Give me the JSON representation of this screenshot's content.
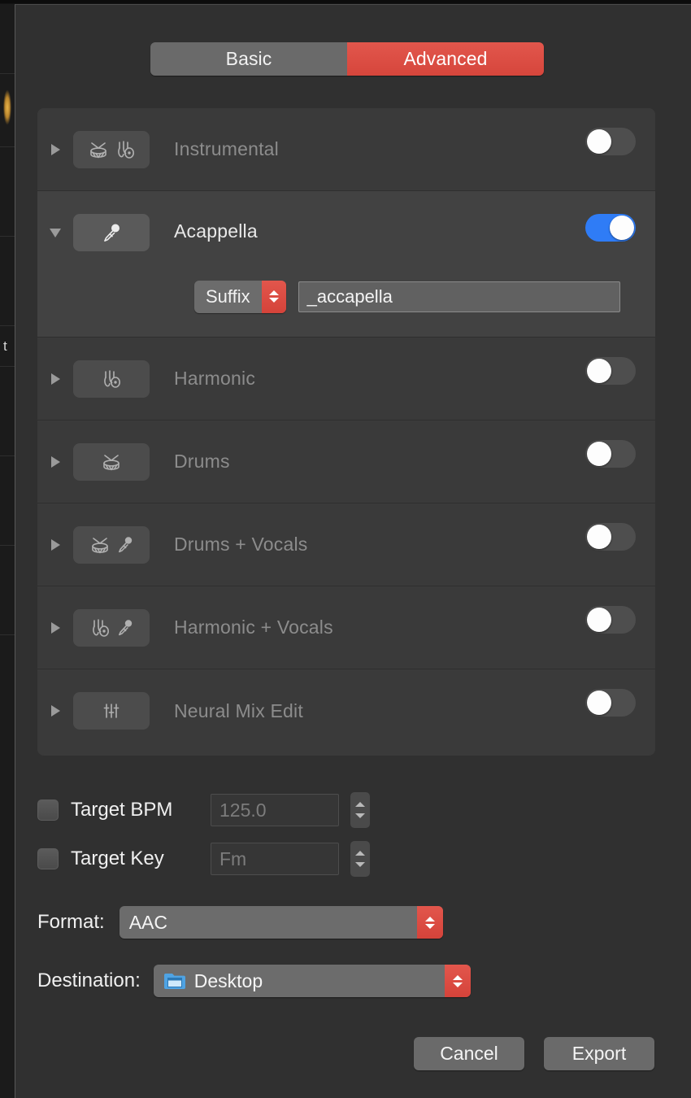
{
  "segmented": {
    "tabs": [
      {
        "label": "Basic",
        "active": false
      },
      {
        "label": "Advanced",
        "active": true
      }
    ],
    "accent": "#d6463c"
  },
  "stems": [
    {
      "label": "Instrumental",
      "icons": [
        "drum-icon",
        "guitar-icon"
      ],
      "enabled": false,
      "expanded": false,
      "disclosure": "chevron-right-icon"
    },
    {
      "label": "Acappella",
      "icons": [
        "microphone-icon"
      ],
      "enabled": true,
      "expanded": true,
      "disclosure": "chevron-down-icon"
    },
    {
      "label": "Harmonic",
      "icons": [
        "guitar-icon"
      ],
      "enabled": false,
      "expanded": false,
      "disclosure": "chevron-right-icon"
    },
    {
      "label": "Drums",
      "icons": [
        "drum-icon"
      ],
      "enabled": false,
      "expanded": false,
      "disclosure": "chevron-right-icon"
    },
    {
      "label": "Drums + Vocals",
      "icons": [
        "drum-icon",
        "microphone-icon"
      ],
      "enabled": false,
      "expanded": false,
      "disclosure": "chevron-right-icon"
    },
    {
      "label": "Harmonic + Vocals",
      "icons": [
        "guitar-icon",
        "microphone-icon"
      ],
      "enabled": false,
      "expanded": false,
      "disclosure": "chevron-right-icon"
    },
    {
      "label": "Neural Mix Edit",
      "icons": [
        "faders-icon"
      ],
      "enabled": false,
      "expanded": false,
      "disclosure": "chevron-right-icon"
    }
  ],
  "suffix": {
    "mode_label": "Suffix",
    "value": "_accapella",
    "stepper": "stepper-red-icon"
  },
  "targets": [
    {
      "label": "Target BPM",
      "value": "125.0",
      "checked": false
    },
    {
      "label": "Target Key",
      "value": "Fm",
      "checked": false
    }
  ],
  "format": {
    "label": "Format:",
    "value": "AAC"
  },
  "destination": {
    "label": "Destination:",
    "value": "Desktop",
    "icon": "folder-icon"
  },
  "footer": {
    "cancel_label": "Cancel",
    "export_label": "Export"
  }
}
